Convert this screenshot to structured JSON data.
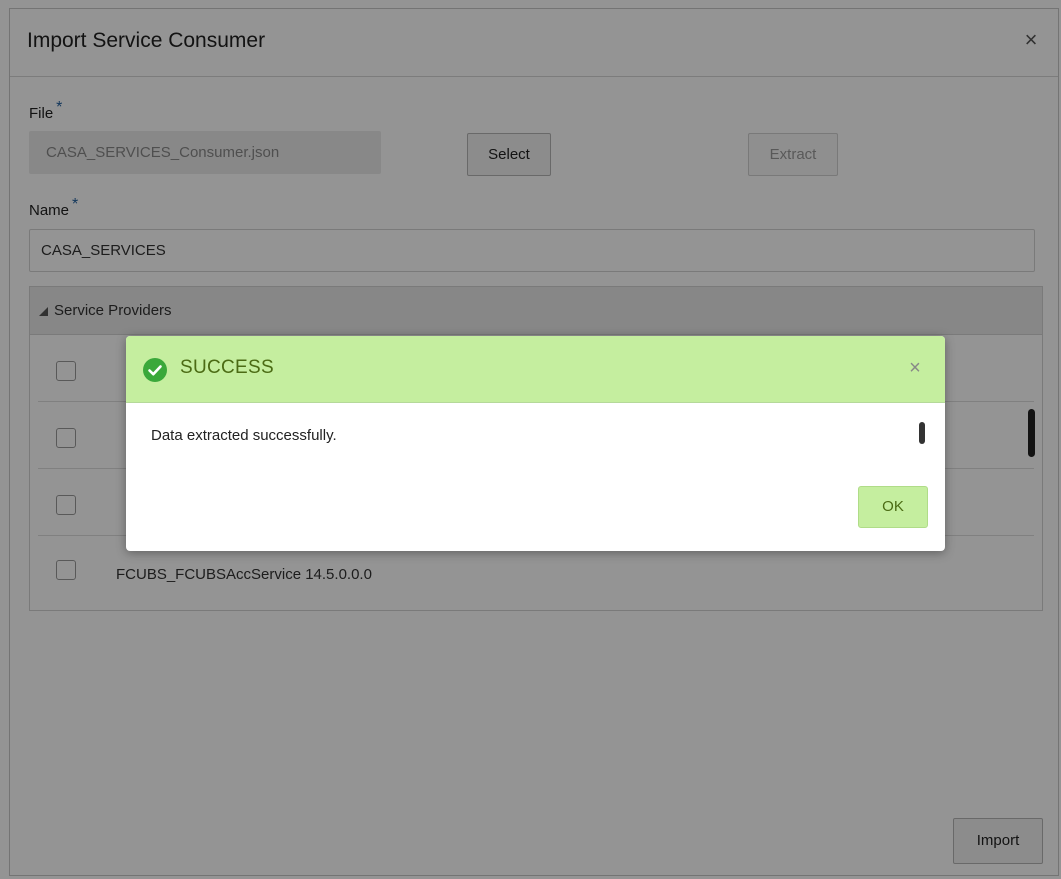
{
  "dialog": {
    "title": "Import Service Consumer",
    "close_symbol": "×"
  },
  "form": {
    "file_label": "File",
    "file_value": "CASA_SERVICES_Consumer.json",
    "select_label": "Select",
    "extract_label": "Extract",
    "name_label": "Name",
    "name_value": "CASA_SERVICES",
    "required_mark": "*"
  },
  "providers": {
    "title": "Service Providers",
    "rows": [
      {
        "label": ""
      },
      {
        "label": ""
      },
      {
        "label": ""
      },
      {
        "label": "FCUBS_FCUBSAccService 14.5.0.0.0"
      }
    ]
  },
  "footer": {
    "import_label": "Import"
  },
  "modal": {
    "title": "SUCCESS",
    "message": "Data extracted successfully.",
    "ok_label": "OK",
    "close_symbol": "×",
    "icon": "check-circle-icon"
  },
  "colors": {
    "success_bg": "#c5ee9f",
    "success_text": "#4b6b14",
    "success_icon": "#3aa83a",
    "required": "#1f5e9e"
  }
}
